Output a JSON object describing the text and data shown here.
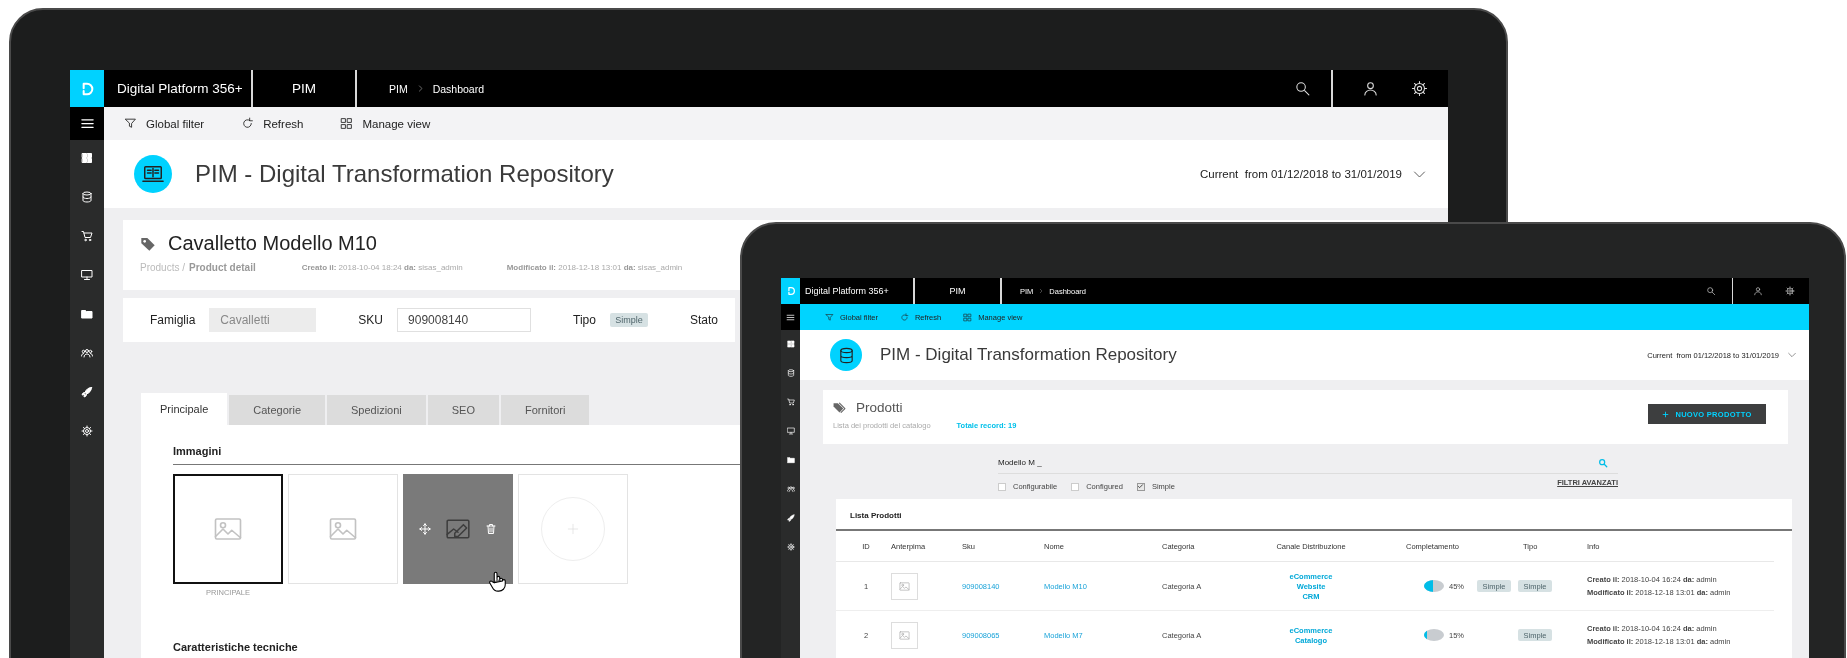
{
  "left_screen": {
    "topbar": {
      "app_name": "Digital Platform 356+",
      "module": "PIM",
      "breadcrumb": [
        "PIM",
        "Dashboard"
      ]
    },
    "toolbar": [
      {
        "kind": "filter",
        "label": "Global filter"
      },
      {
        "kind": "refresh",
        "label": "Refresh"
      },
      {
        "kind": "grid",
        "label": "Manage view"
      }
    ],
    "header": {
      "title": "PIM -  Digital Transformation Repository",
      "period": "Current  from 01/12/2018 to 31/01/2019"
    },
    "product": {
      "title": "Cavalletto Modello M10",
      "breadcrumb": {
        "parent": "Products /",
        "current": "Product detail"
      },
      "meta": [
        "**Creato il:** 2018-10-04 18:24 **da:** sisas_admin",
        "**Modificato il:** 2018-12-18 13:01 **da:** sisas_admin"
      ]
    },
    "fields": [
      {
        "kind": "readonly",
        "label": "Famiglia",
        "value": "Cavalletti"
      },
      {
        "kind": "input",
        "label": "SKU",
        "value": "909008140"
      },
      {
        "kind": "badge",
        "label": "Tipo",
        "value": "Simple"
      },
      {
        "kind": "label",
        "label": "Stato"
      }
    ],
    "tabs": [
      {
        "label": "Principale",
        "selected": true
      },
      {
        "label": "Categorie",
        "selected": false
      },
      {
        "label": "Spedizioni",
        "selected": false
      },
      {
        "label": "SEO",
        "selected": false
      },
      {
        "label": "Fornitori",
        "selected": false
      }
    ],
    "images": {
      "title": "Immagini",
      "tiles": [
        {
          "kind": "image",
          "selected": true,
          "caption": "PRINCIPALE"
        },
        {
          "kind": "image",
          "selected": false
        },
        {
          "kind": "hover",
          "selected": false
        },
        {
          "kind": "add",
          "selected": false
        }
      ]
    },
    "next_section": "Caratteristiche tecniche"
  },
  "right_screen": {
    "topbar": {
      "app_name": "Digital Platform 356+",
      "module": "PIM",
      "breadcrumb": [
        "PIM",
        "Dashboard"
      ]
    },
    "toolbar": [
      {
        "kind": "filter",
        "label": "Global filter"
      },
      {
        "kind": "refresh",
        "label": "Refresh"
      },
      {
        "kind": "grid",
        "label": "Manage view"
      }
    ],
    "header": {
      "title": "PIM -  Digital Transformation Repository",
      "period": "Current  from 01/12/2018 to 31/01/2019"
    },
    "products": {
      "title": "Prodotti",
      "subtitle": "Lista dei prodotti del catalogo",
      "total": "Totale record: 19",
      "new_button": "NUOVO PRODOTTO"
    },
    "search": {
      "value": "Modello M _"
    },
    "filters": [
      {
        "label": "Configurabile",
        "checked": false
      },
      {
        "label": "Configured",
        "checked": false
      },
      {
        "label": "Simple",
        "checked": true
      }
    ],
    "advanced_filters": "FILTRI AVANZATI",
    "list": {
      "title": "Lista Prodotti",
      "columns": [
        "ID",
        "Anterpima",
        "Sku",
        "Nome",
        "Categoria",
        "Canale Distribuzione",
        "Completamento",
        "Tipo",
        "Info"
      ],
      "rows": [
        {
          "id": "1",
          "sku": "909008140",
          "name": "Modello M10",
          "category": "Categoria A",
          "channels": [
            "eCommerce",
            "Website",
            "CRM"
          ],
          "completion": {
            "level": 0.45,
            "text": "45%",
            "badge": "Simple"
          },
          "type": "Simple",
          "info": [
            "**Creato il:** 2018-10-04 16:24 **da:** admin",
            "**Modificato il:** 2018-12-18 13:01 **da:** admin"
          ]
        },
        {
          "id": "2",
          "sku": "909008065",
          "name": "Modello M7",
          "category": "Categoria A",
          "channels": [
            "eCommerce",
            "Catalogo"
          ],
          "completion": {
            "level": 0.15,
            "text": "15%"
          },
          "type": "Simple",
          "info": [
            "**Creato il:** 2018-10-04 16:24 **da:** admin",
            "**Modificato il:** 2018-12-18 13:01 **da:** admin"
          ]
        }
      ]
    }
  }
}
